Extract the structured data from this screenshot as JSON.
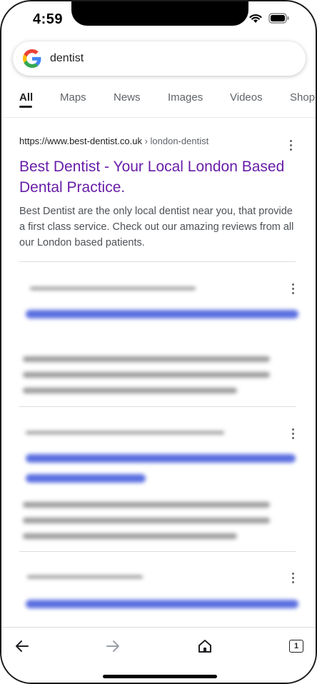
{
  "status": {
    "time": "4:59"
  },
  "search": {
    "query": "dentist"
  },
  "tabs": [
    {
      "label": "All",
      "active": true
    },
    {
      "label": "Maps"
    },
    {
      "label": "News"
    },
    {
      "label": "Images"
    },
    {
      "label": "Videos"
    },
    {
      "label": "Shop"
    }
  ],
  "results": [
    {
      "url": "https://www.best-dentist.co.uk",
      "breadcrumb": " › london-dentist",
      "title": "Best Dentist - Your Local London Based Dental Practice.",
      "snippet": "Best Dentist are the only local dentist near you, that provide a first class service. Check out our amazing reviews from all our London based patients."
    }
  ],
  "bottom_nav": {
    "tab_count": "1"
  },
  "colors": {
    "link": "#681da8",
    "snippet": "#4d5156",
    "accent": "#202124"
  }
}
